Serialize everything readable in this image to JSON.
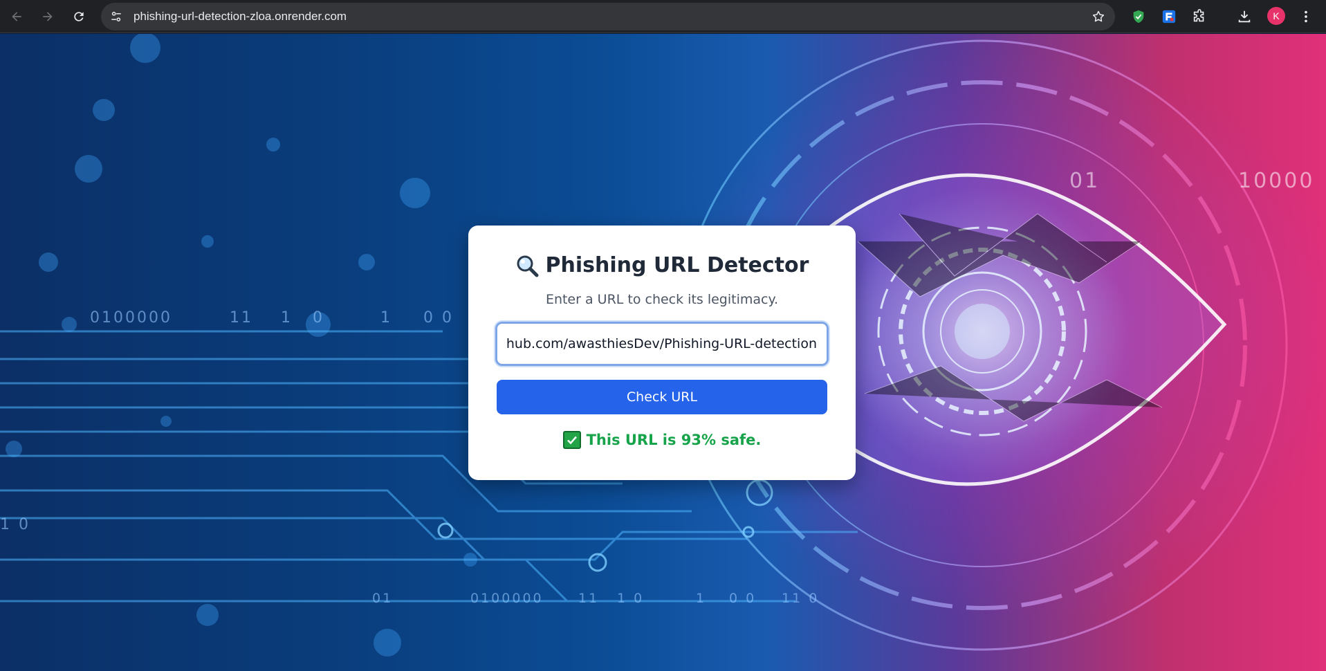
{
  "browser": {
    "url": "phishing-url-detection-zloa.onrender.com",
    "profile_initial": "K",
    "icons": {
      "back": "arrow-left-icon",
      "forward": "arrow-right-icon",
      "reload": "reload-icon",
      "site_info": "tune-icon",
      "bookmark": "star-icon",
      "extension_1": "shield-check-icon",
      "extension_2": "extension-app-icon",
      "extensions": "puzzle-icon",
      "downloads": "download-icon",
      "menu": "more-vert-icon"
    }
  },
  "background": {
    "binary_text": [
      "0100000",
      "11",
      "1",
      "0",
      "1",
      "0 0",
      "1 0",
      "01",
      "0100000",
      "11",
      "1 0",
      "1",
      "0 0",
      "11 0",
      "01",
      "10000"
    ]
  },
  "card": {
    "title_icon": "magnifier-icon",
    "title": "Phishing URL Detector",
    "subtitle": "Enter a URL to check its legitimacy.",
    "input_value": "https://github.com/awasthiesDev/Phishing-URL-detection",
    "button_label": "Check URL",
    "result_icon": "check-mark-icon",
    "result_text": "This URL is 93% safe.",
    "colors": {
      "button": "#2563eb",
      "result": "#16a34a"
    }
  }
}
